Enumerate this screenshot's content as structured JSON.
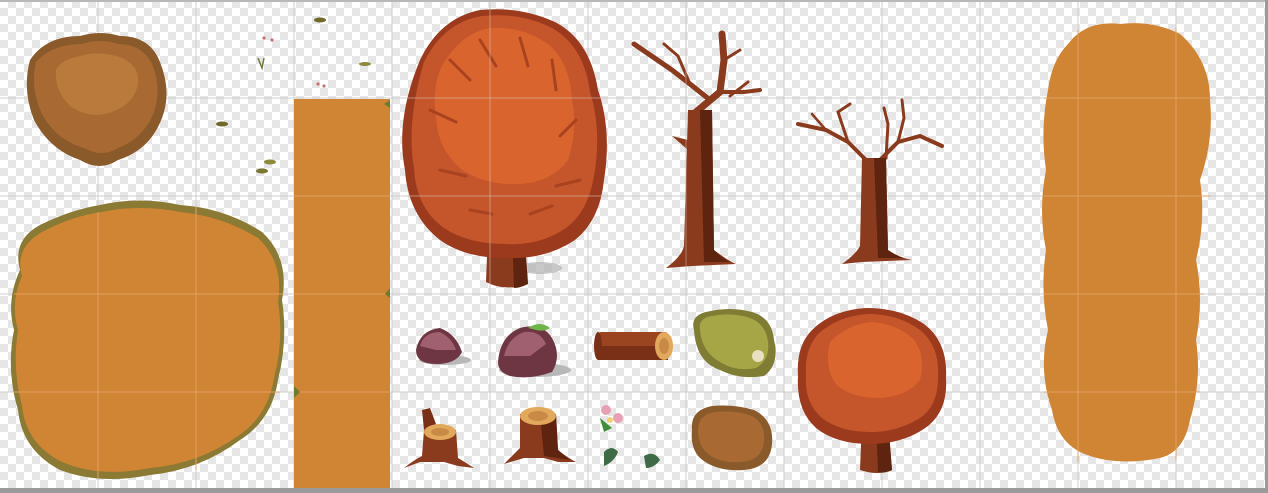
{
  "tileset": {
    "colors": {
      "ground": "#d08534",
      "ground_edge": "#8b6a2e",
      "leaf_light": "#d9642e",
      "leaf_mid": "#c5552a",
      "leaf_dark": "#9c3a1e",
      "bark": "#8a3b1d",
      "bark_dark": "#5e2410",
      "bush_brown": "#a86a32",
      "moss": "#a7a647",
      "rock": "#8b4c5a",
      "grid_line": "#c8c8c8"
    },
    "sprites": [
      {
        "name": "brown-bush"
      },
      {
        "name": "ground-patch-round"
      },
      {
        "name": "grass-tufts"
      },
      {
        "name": "ground-column"
      },
      {
        "name": "autumn-tree-large"
      },
      {
        "name": "bare-tree-tall"
      },
      {
        "name": "bare-tree-short"
      },
      {
        "name": "rock-small"
      },
      {
        "name": "rock-mossy"
      },
      {
        "name": "log"
      },
      {
        "name": "moss-bush"
      },
      {
        "name": "autumn-tree-small"
      },
      {
        "name": "stump-roots"
      },
      {
        "name": "stump"
      },
      {
        "name": "flowers-leaves"
      },
      {
        "name": "brown-bush-small"
      },
      {
        "name": "ground-patch-tall"
      }
    ]
  }
}
